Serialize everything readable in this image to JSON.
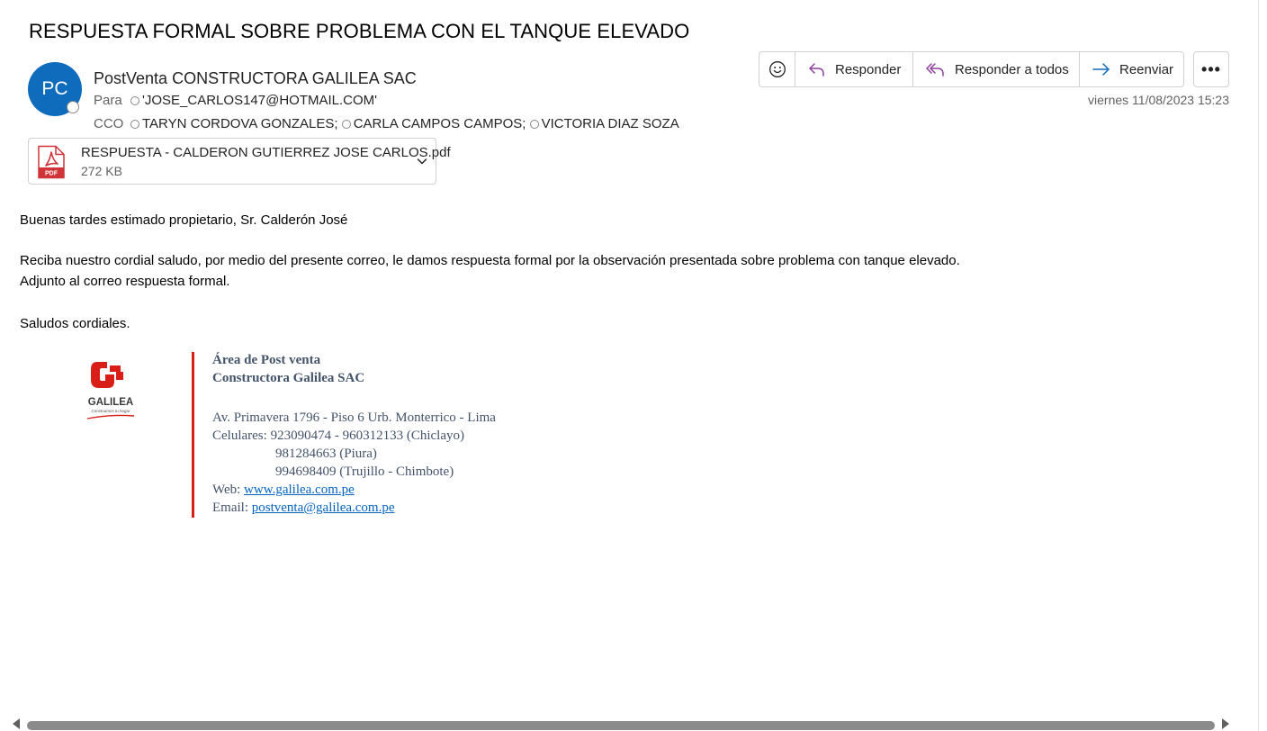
{
  "email": {
    "subject": "RESPUESTA FORMAL SOBRE PROBLEMA CON EL TANQUE ELEVADO",
    "avatar_initials": "PC",
    "sender": "PostVenta CONSTRUCTORA GALILEA SAC",
    "to_label": "Para",
    "to": [
      "'JOSE_CARLOS147@HOTMAIL.COM'"
    ],
    "bcc_label": "CCO",
    "bcc": [
      "TARYN CORDOVA GONZALES;",
      "CARLA CAMPOS CAMPOS;",
      "VICTORIA DIAZ SOZA"
    ],
    "date": "viernes 11/08/2023 15:23"
  },
  "toolbar": {
    "emoji_icon": "smiley-icon",
    "reply_label": "Responder",
    "reply_all_label": "Responder a todos",
    "forward_label": "Reenviar",
    "more_label": "•••"
  },
  "attachment": {
    "name": "RESPUESTA - CALDERON GUTIERREZ JOSE CARLOS.pdf",
    "size": "272 KB",
    "icon_text": "PDF",
    "icon": "pdf-icon"
  },
  "body": {
    "greeting": "Buenas tardes estimado propietario, Sr. Calderón José",
    "line1": "Reciba nuestro cordial saludo, por medio del presente correo, le damos respuesta formal por la observación presentada sobre problema con tanque elevado.",
    "line2": "Adjunto al correo respuesta formal.",
    "closing": "Saludos cordiales."
  },
  "signature": {
    "logo_name": "GALILEA",
    "logo_tagline": "Construimos tu hogar",
    "dept": "Área de Post venta",
    "company": "Constructora Galilea SAC",
    "address": "Av. Primavera 1796 - Piso 6 Urb. Monterrico - Lima",
    "phones_label": "Celulares:",
    "phone1": "923090474 - 960312133 (Chiclayo)",
    "phone2": "981284663 (Piura)",
    "phone3": "994698409 (Trujillo - Chimbote)",
    "web_label": "Web:",
    "web": "www.galilea.com.pe",
    "email_label": "Email:",
    "email": "postventa@galilea.com.pe"
  },
  "colors": {
    "avatar": "#0f6cbd",
    "reply_icon": "#8e3f9b",
    "forward_icon": "#0f6cbd",
    "signature_bar": "#d91e18",
    "signature_text": "#44546a",
    "link": "#0563c1"
  }
}
